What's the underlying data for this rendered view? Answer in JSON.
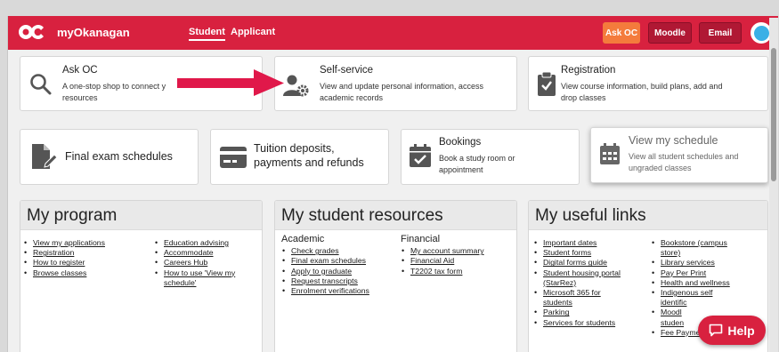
{
  "nav": {
    "brand": "myOkanagan",
    "logo_text": "OC",
    "tabs": [
      "Student",
      "Applicant"
    ],
    "ask_oc": "Ask OC",
    "moodle": "Moodle",
    "email": "Email"
  },
  "cards": {
    "ask": {
      "title": "Ask OC",
      "desc": "A one-stop shop to connect y",
      "desc2": "resources",
      "icon": "search-icon"
    },
    "self": {
      "title": "Self-service",
      "desc": "View and update personal information, access",
      "desc2": "academic records",
      "icon": "user-gear-icon"
    },
    "registration": {
      "title": "Registration",
      "desc": "View course information, build plans, add and",
      "desc2": "drop classes",
      "icon": "clipboard-check-icon"
    },
    "final": {
      "title": "Final exam schedules",
      "icon": "document-pen-icon"
    },
    "tuition": {
      "title": "Tuition deposits,",
      "title2": "payments and refunds",
      "icon": "credit-card-icon"
    },
    "bookings": {
      "title": "Bookings",
      "desc": "Book a study room or",
      "desc2": "appointment",
      "icon": "calendar-check-icon"
    },
    "schedule": {
      "title": "View my schedule",
      "desc": "View all student schedules and",
      "desc2": "ungraded classes",
      "icon": "calendar-grid-icon"
    }
  },
  "program": {
    "title": "My program",
    "col1": [
      "View my applications",
      "Registration",
      "How to register",
      "Browse classes"
    ],
    "col2": [
      "Education advising",
      "Accommodate",
      "Careers Hub",
      "How to use 'View my",
      "schedule'"
    ]
  },
  "resources": {
    "title": "My student resources",
    "academic_heading": "Academic",
    "financial_heading": "Financial",
    "academic": [
      "Check grades",
      "Final exam schedules",
      "Apply to graduate",
      "Request transcripts",
      "Enrolment verifications"
    ],
    "financial": [
      "My account summary",
      "Financial Aid",
      "T2202 tax form"
    ]
  },
  "links": {
    "title": "My useful links",
    "col1": [
      "Important dates",
      "Student forms",
      "Digital forms guide",
      "Student housing portal",
      "(StarRez)",
      "Microsoft 365 for",
      "students",
      "Parking",
      "Services for students"
    ],
    "col2": [
      "Bookstore (campus",
      "store)",
      "Library services",
      "Pay Per Print",
      "Health and wellness",
      "Indigenous self",
      "identific",
      "Moodl",
      "studen",
      "Fee Payment"
    ]
  },
  "help": {
    "label": "Help"
  },
  "colors": {
    "brand_red": "#d8213f",
    "accent_orange": "#f47b3c"
  }
}
